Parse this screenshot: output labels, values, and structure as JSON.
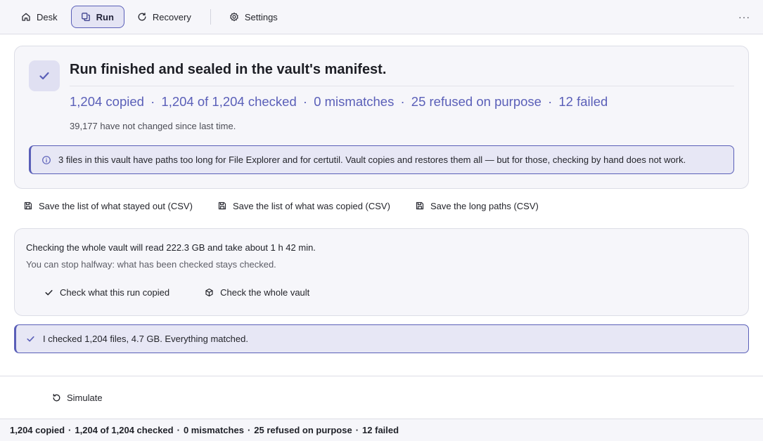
{
  "nav": {
    "items": [
      {
        "label": "Desk",
        "icon": "home-icon",
        "active": false
      },
      {
        "label": "Run",
        "icon": "copy-icon",
        "active": true
      },
      {
        "label": "Recovery",
        "icon": "refresh-icon",
        "active": false
      },
      {
        "label": "Settings",
        "icon": "settings-icon",
        "active": false
      }
    ],
    "more_label": "···"
  },
  "summary": {
    "title": "Run finished and sealed in the vault's manifest.",
    "stats": {
      "copied": "1,204 copied",
      "checked": "1,204 of 1,204 checked",
      "mismatches": "0 mismatches",
      "refused": "25 refused on purpose",
      "failed": "12 failed",
      "separator": "·"
    },
    "unchanged_note": "39,177 have not changed since last time.",
    "notice": "3 files in this vault have paths too long for File Explorer and for certutil. Vault copies and restores them all — but for those, checking by hand does not work."
  },
  "exports": [
    {
      "label": "Save the list of what stayed out (CSV)",
      "icon": "save-icon"
    },
    {
      "label": "Save the list of what was copied (CSV)",
      "icon": "save-icon"
    },
    {
      "label": "Save the long paths (CSV)",
      "icon": "save-icon"
    }
  ],
  "verify": {
    "line1": "Checking the whole vault will read 222.3 GB and take about 1 h 42 min.",
    "line2": "You can stop halfway: what has been checked stays checked.",
    "check_run_label": "Check what this run copied",
    "check_vault_label": "Check the whole vault"
  },
  "result": {
    "text": "I checked 1,204 files, 4.7 GB. Everything matched."
  },
  "simulate": {
    "label": "Simulate"
  },
  "statusbar": {
    "copied": "1,204 copied",
    "checked": "1,204 of 1,204 checked",
    "mismatches": "0 mismatches",
    "refused": "25 refused on purpose",
    "failed": "12 failed",
    "separator": "·"
  },
  "colors": {
    "accent": "#5a5fb8",
    "accent_bg": "#e7e7f5",
    "panel_bg": "#f6f6fa",
    "border": "#dcdde6"
  }
}
